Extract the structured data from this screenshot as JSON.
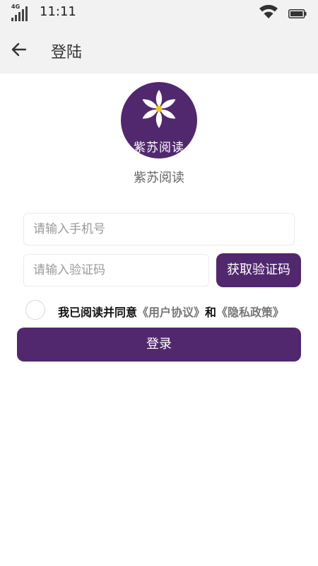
{
  "status_bar": {
    "network": "4G",
    "time": "11:11",
    "icons": [
      "signal-icon",
      "wifi-icon",
      "battery-icon"
    ]
  },
  "app_bar": {
    "back_icon": "arrow-left-icon",
    "title": "登陆"
  },
  "logo": {
    "text": "紫苏阅读",
    "bg_color": "#51286e"
  },
  "app_name": "紫苏阅读",
  "form": {
    "phone_placeholder": "请输入手机号",
    "phone_value": "",
    "code_placeholder": "请输入验证码",
    "code_value": "",
    "get_code_label": "获取验证码",
    "agreement": {
      "checked": false,
      "prefix": "我已阅读并同意",
      "user_agreement": "《用户协议》",
      "conjunction": "和",
      "privacy_policy": "《隐私政策》"
    },
    "login_label": "登录"
  },
  "colors": {
    "accent": "#51286e",
    "header_bg": "#f2f2f2"
  }
}
